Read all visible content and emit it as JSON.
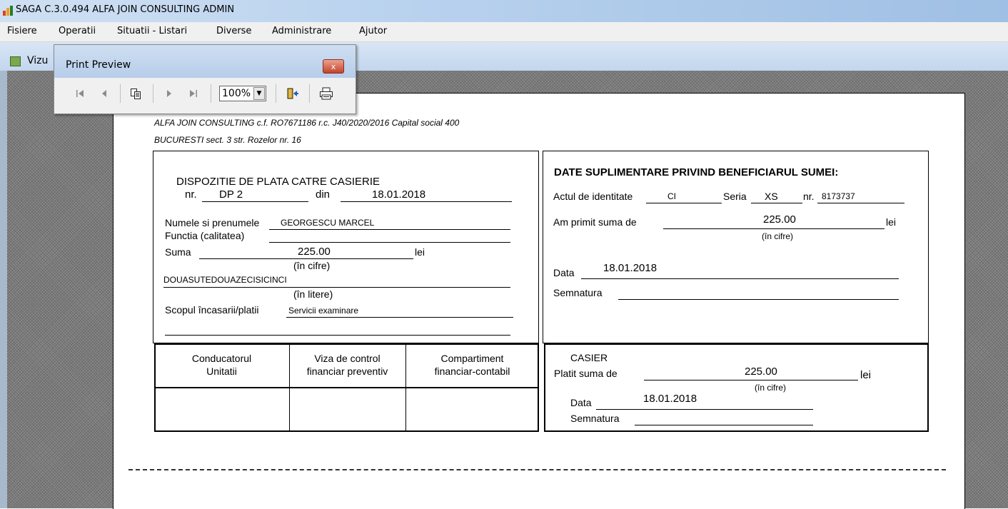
{
  "app": {
    "title": "SAGA C.3.0.494  ALFA JOIN CONSULTING  ADMIN",
    "menu": [
      "Fisiere",
      "Operatii",
      "Situatii - Listari",
      "Diverse",
      "Administrare",
      "Ajutor"
    ],
    "child_title": "Vizu"
  },
  "print_preview": {
    "title": "Print Preview",
    "close_label": "x",
    "zoom": "100%"
  },
  "document": {
    "company_line1": "ALFA JOIN CONSULTING   c.f. RO7671186  r.c. J40/2020/2016  Capital social 400",
    "company_line2": "BUCURESTI sect. 3 str. Rozelor nr. 16",
    "left": {
      "title": "DISPOZITIE DE PLATA CATRE CASIERIE",
      "nr_label": "nr.",
      "nr_value": "DP 2",
      "din_label": "din",
      "date": "18.01.2018",
      "name_label": "Numele si prenumele",
      "name_value": "GEORGESCU MARCEL",
      "functia_label": "Functia (calitatea)",
      "suma_label": "Suma",
      "suma_value": "225.00",
      "lei": "lei",
      "in_cifre": "(în cifre)",
      "suma_litere": "DOUASUTEDOUAZECISICINCI",
      "in_litere": "(în litere)",
      "scop_label": "Scopul încasarii/platii",
      "scop_value": "Servicii examinare"
    },
    "right": {
      "title": "DATE SUPLIMENTARE PRIVIND BENEFICIARUL SUMEI:",
      "act_label": "Actul de identitate",
      "act_value": "CI",
      "seria_label": "Seria",
      "seria_value": "XS",
      "nr_label": "nr.",
      "nr_value": "8173737",
      "primit_label": "Am primit suma de",
      "primit_value": "225.00",
      "lei": "lei",
      "in_cifre": "(în cifre)",
      "data_label": "Data",
      "data_value": "18.01.2018",
      "semnatura_label": "Semnatura"
    },
    "signatures": {
      "col1": [
        "Conducatorul",
        "Unitatii"
      ],
      "col2": [
        "Viza de control",
        "financiar preventiv"
      ],
      "col3": [
        "Compartiment",
        "financiar-contabil"
      ]
    },
    "casier": {
      "title": "CASIER",
      "platit_label": "Platit suma de",
      "platit_value": "225.00",
      "lei": "lei",
      "in_cifre": "(în cifre)",
      "data_label": "Data",
      "data_value": "18.01.2018",
      "semnatura_label": "Semnatura"
    }
  }
}
